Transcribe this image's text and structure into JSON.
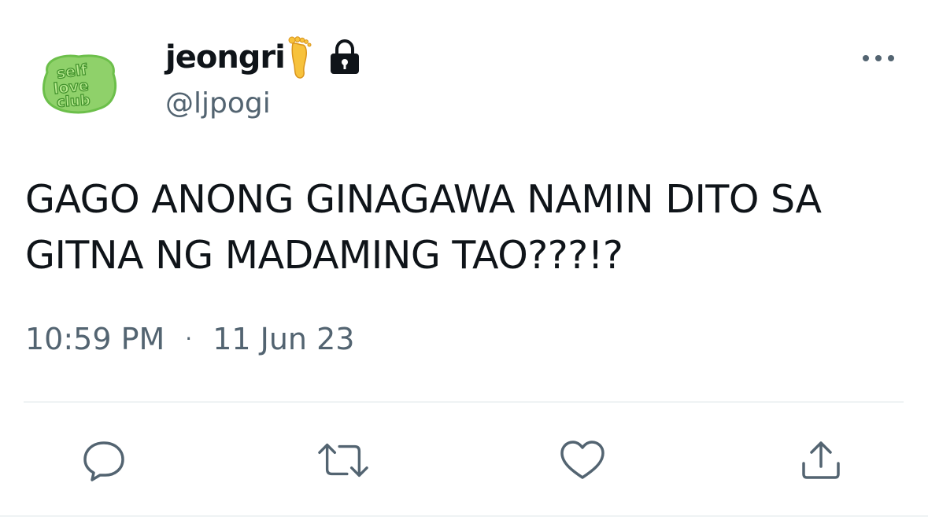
{
  "tweet": {
    "avatar_text": [
      "self",
      "love",
      "club"
    ],
    "display_name": "jeongri",
    "handle": "@ljpogi",
    "name_icons": [
      "foot-emoji-icon",
      "lock-icon"
    ],
    "text": "GAGO ANONG GINAGAWA NAMIN DITO SA\nGITNA NG MADAMING TAO???!?",
    "time": "10:59 PM",
    "separator": "·",
    "date": "11 Jun 23"
  },
  "actions": {
    "icons": [
      "reply-icon",
      "retweet-icon",
      "like-icon",
      "share-icon"
    ]
  },
  "colors": {
    "text_primary": "#0f1419",
    "text_secondary": "#536471",
    "divider": "#eff3f4",
    "avatar_green": "#8fd16a",
    "avatar_dark_green": "#3f8f2a"
  }
}
